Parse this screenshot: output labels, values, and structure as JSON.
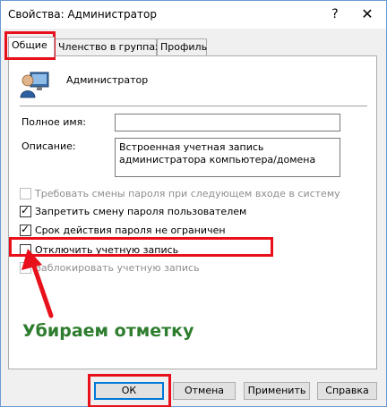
{
  "window": {
    "title": "Свойства: Администратор",
    "help_glyph": "?",
    "close_glyph": "✕"
  },
  "tabs": [
    {
      "label": "Общие",
      "active": true
    },
    {
      "label": "Членство в группах",
      "active": false
    },
    {
      "label": "Профиль",
      "active": false
    }
  ],
  "general": {
    "user_name": "Администратор",
    "full_name_label": "Полное имя:",
    "full_name_value": "",
    "description_label": "Описание:",
    "description_value": "Встроенная учетная запись администратора компьютера/домена"
  },
  "checkboxes": [
    {
      "label": "Требовать смены пароля при следующем входе в систему",
      "checked": false,
      "enabled": false
    },
    {
      "label": "Запретить смену пароля пользователем",
      "checked": true,
      "enabled": true
    },
    {
      "label": "Срок действия пароля не ограничен",
      "checked": true,
      "enabled": true
    },
    {
      "label": "Отключить учетную запись",
      "checked": false,
      "enabled": true
    },
    {
      "label": "Заблокировать учетную запись",
      "checked": false,
      "enabled": false
    }
  ],
  "annotation": {
    "text": "Убираем отметку",
    "color": "#2e7d2e",
    "highlight_color": "#e8111b"
  },
  "buttons": {
    "ok": "ОК",
    "cancel": "Отмена",
    "apply": "Применить",
    "help": "Справка"
  },
  "icons": {
    "user": "user-icon",
    "check": "✓"
  }
}
